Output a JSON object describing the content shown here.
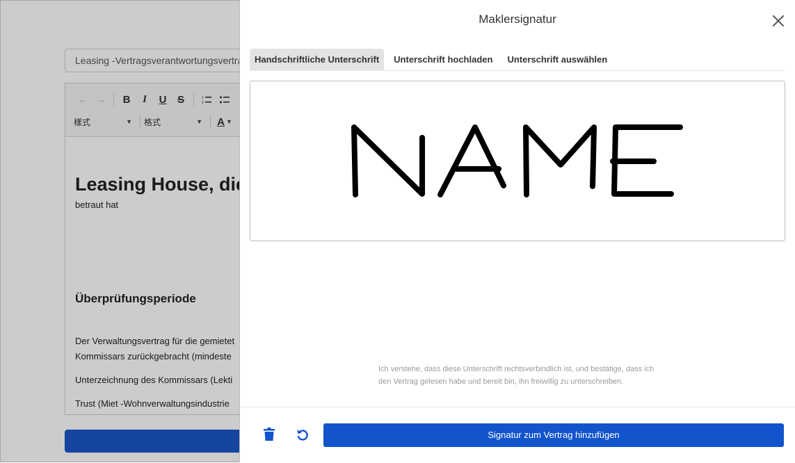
{
  "background_editor": {
    "title_field": "Leasing -Vertragsverantwortungsvertrag",
    "toolbar": {
      "style_select": "樣式",
      "format_select": "格式"
    },
    "content": {
      "heading": "Leasing House, die",
      "subline": "betraut hat",
      "section_heading": "Überprüfungsperiode",
      "paragraph_1a": "Der Verwaltungsvertrag für die gemietet",
      "paragraph_1b": "Kommissars zurückgebracht (mindeste",
      "paragraph_2": "Unterzeichnung des Kommissars (Lekti",
      "paragraph_3": "Trust (Miet -Wohnverwaltungsindustrie"
    }
  },
  "modal": {
    "title": "Maklersignatur",
    "tabs": [
      {
        "label": "Handschriftliche Unterschrift",
        "active": true
      },
      {
        "label": "Unterschrift hochladen",
        "active": false
      },
      {
        "label": "Unterschrift auswählen",
        "active": false
      }
    ],
    "signature_text": "NAME",
    "legal_text": "Ich verstehe, dass diese Unterschrift rechtsverbindlich ist, und bestätige, dass ich den Vertrag gelesen habe und bereit bin, ihn freiwillig zu unterschreiben.",
    "submit_label": "Signatur zum Vertrag hinzufügen"
  },
  "colors": {
    "primary": "#1254cc",
    "overlay": "rgba(0,0,0,0.2)",
    "active_tab": "#e3e3e3"
  },
  "icons": [
    "undo-arrow-icon",
    "redo-arrow-icon",
    "bold-icon",
    "italic-icon",
    "underline-icon",
    "strikethrough-icon",
    "numbered-list-icon",
    "bullet-list-icon",
    "text-color-icon",
    "close-icon",
    "trash-icon",
    "reset-icon"
  ]
}
